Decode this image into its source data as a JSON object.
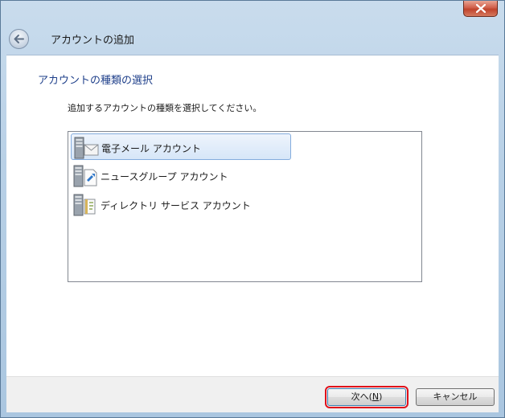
{
  "window": {
    "title": "アカウントの追加"
  },
  "titlebar": {
    "close_icon": "close-x-icon",
    "back_icon": "back-arrow-icon"
  },
  "content": {
    "heading": "アカウントの種類の選択",
    "instruction": "追加するアカウントの種類を選択してください。",
    "account_types": [
      {
        "label": "電子メール アカウント",
        "icon": "email-server-icon",
        "selected": true
      },
      {
        "label": "ニュースグループ アカウント",
        "icon": "newsgroup-server-icon",
        "selected": false
      },
      {
        "label": "ディレクトリ サービス アカウント",
        "icon": "directory-server-icon",
        "selected": false
      }
    ]
  },
  "footer": {
    "next_label_prefix": "次へ(",
    "next_label_accel": "N",
    "next_label_suffix": ")",
    "cancel_label": "キャンセル"
  },
  "colors": {
    "heading": "#1e3f8a",
    "selection": "#d6e6f8",
    "highlight_outline": "#e0101a"
  }
}
